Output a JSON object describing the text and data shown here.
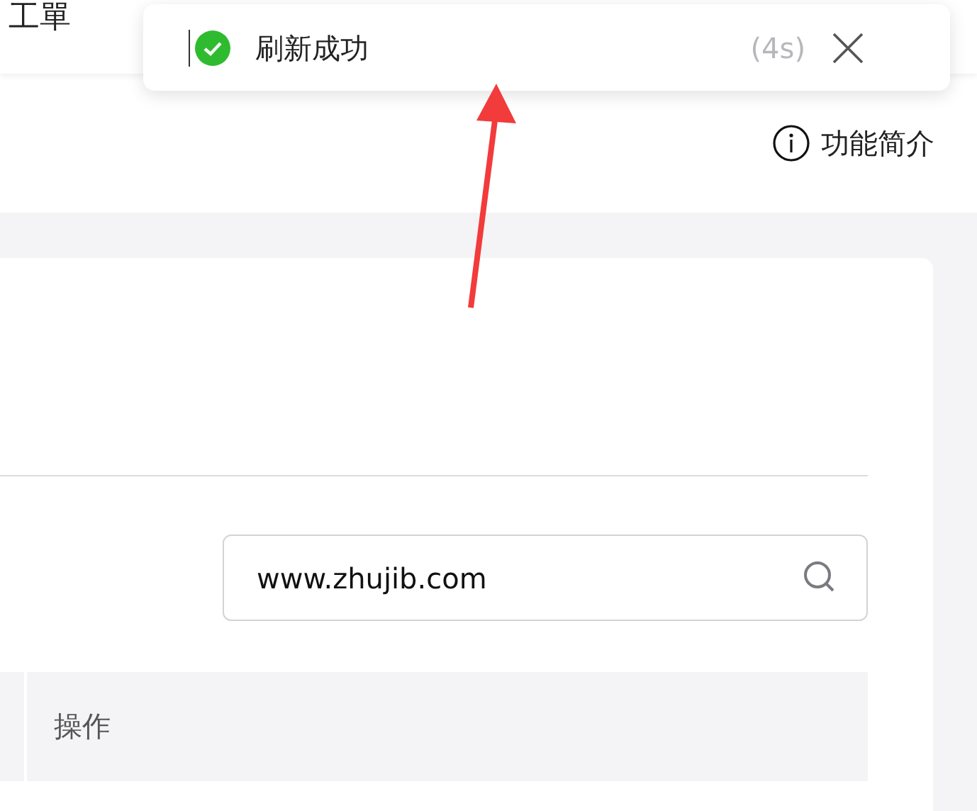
{
  "nav": {
    "items": [
      {
        "label": "工單"
      }
    ]
  },
  "toast": {
    "message": "刷新成功",
    "countdown": "(4s)"
  },
  "help_link": {
    "label": "功能简介"
  },
  "search": {
    "value": "www.zhujib.com"
  },
  "table": {
    "columns": [
      "操作"
    ]
  }
}
